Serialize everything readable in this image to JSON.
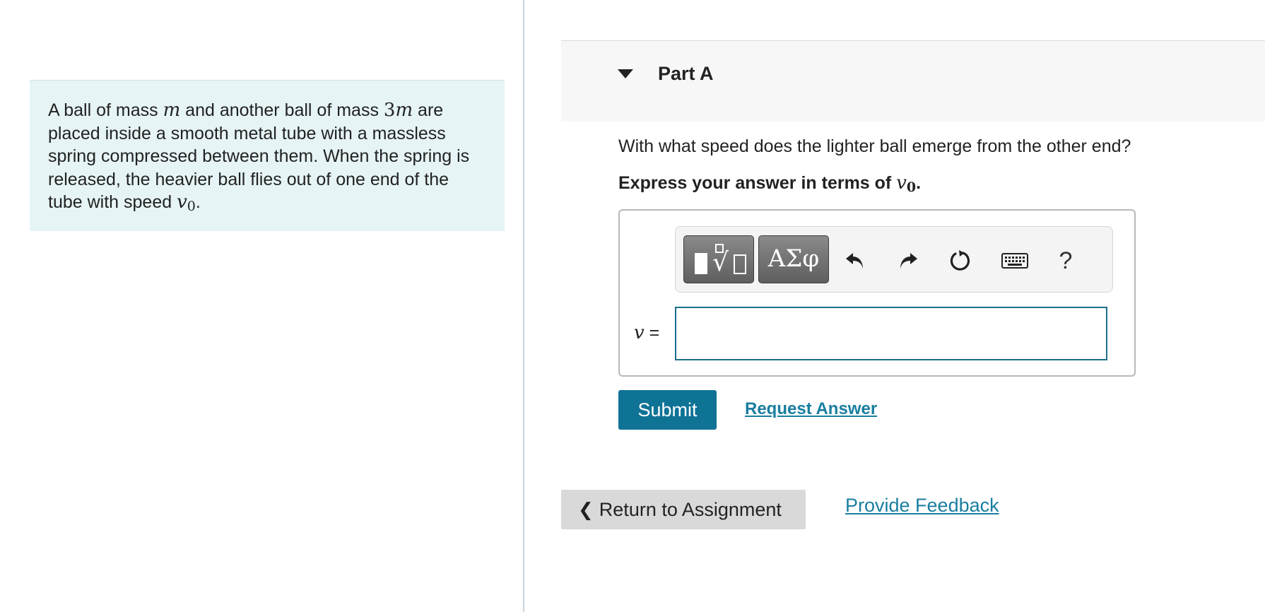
{
  "problem": {
    "t1": "A ball of mass ",
    "m1": "m",
    "t2": " and another ball of mass ",
    "m2_coef": "3",
    "m2_var": "m",
    "t3": " are placed inside a smooth metal tube with a massless spring compressed between them. When the spring is released, the heavier ball flies out of one end of the tube with speed ",
    "v_var": "v",
    "v_sub": "0",
    "t4": "."
  },
  "part": {
    "title": "Part A",
    "question": "With what speed does the lighter ball emerge from the other end?",
    "instruction_prefix": "Express your answer in terms of ",
    "instruction_var": "v",
    "instruction_sub": "0",
    "instruction_suffix": "."
  },
  "toolbar": {
    "symbols_label": "ΑΣφ",
    "help_label": "?",
    "icons": [
      "templates-icon",
      "greek-symbols-icon",
      "undo-icon",
      "redo-icon",
      "reset-icon",
      "keyboard-icon",
      "help-icon"
    ]
  },
  "answer": {
    "var_label": "v",
    "equals": " =",
    "value": ""
  },
  "actions": {
    "submit_label": "Submit",
    "request_answer_label": "Request Answer",
    "return_label": "Return to Assignment",
    "feedback_label": "Provide Feedback"
  },
  "colors": {
    "accent": "#0f7396",
    "link": "#1a7ea0",
    "problem_bg": "#e6f4f6",
    "input_border": "#1a6f8a"
  }
}
